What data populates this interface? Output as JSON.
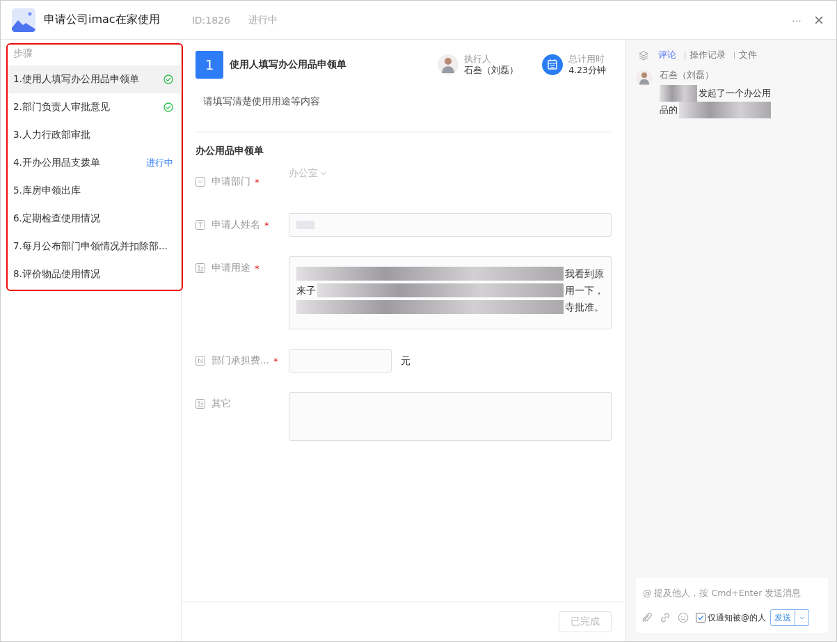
{
  "window": {
    "title": "申请公司imac在家使用",
    "id": "ID:1826",
    "status": "进行中",
    "more": "···",
    "close": "×"
  },
  "steps": {
    "title": "步骤",
    "highlighted": true,
    "items": [
      {
        "label": "1.使用人填写办公用品申领单",
        "selected": true,
        "completed": true
      },
      {
        "label": "2.部门负责人审批意见",
        "selected": false,
        "completed": true
      },
      {
        "label": "3.人力行政部审批",
        "selected": false,
        "completed": false
      },
      {
        "label": "4.开办公用品支拨单",
        "selected": false,
        "completed": false,
        "badge": "进行中"
      },
      {
        "label": "5.库房申领出库",
        "selected": false,
        "completed": false
      },
      {
        "label": "6.定期检查使用情况",
        "selected": false,
        "completed": false
      },
      {
        "label": "7.每月公布部门申领情况并扣除部...",
        "selected": false,
        "completed": false
      },
      {
        "label": "8.评价物品使用情况",
        "selected": false,
        "completed": false
      }
    ]
  },
  "task": {
    "number": "1",
    "title": "使用人填写办公用品申领单",
    "executor_label": "执行人",
    "executor": "石叁（刘磊）",
    "time_label": "总计用时",
    "time": "4.23分钟",
    "description": "请填写清楚使用用途等内容"
  },
  "form": {
    "title": "办公用品申领单",
    "fields": [
      {
        "kind": "select",
        "label": "申请部门",
        "required_mark": "*",
        "value": "办公室"
      },
      {
        "kind": "input",
        "label": "申请人姓名",
        "required_mark": "*",
        "segments": [
          {
            "kind": "redacted"
          }
        ]
      },
      {
        "kind": "textarea",
        "label": "申请用途",
        "required_mark": "*",
        "lines": [
          [
            {
              "kind": "redacted"
            },
            {
              "kind": "text",
              "text": "我看到原"
            }
          ],
          [
            {
              "kind": "text",
              "text": "来子"
            },
            {
              "kind": "redacted"
            },
            {
              "kind": "text",
              "text": "用一下，"
            }
          ],
          [
            {
              "kind": "redacted"
            },
            {
              "kind": "text",
              "text": "寺批准。"
            }
          ]
        ]
      },
      {
        "kind": "number",
        "label": "部门承担费...",
        "required_mark": "*",
        "unit": "元"
      },
      {
        "kind": "textarea",
        "label": "其它"
      }
    ]
  },
  "footer": {
    "button": "已完成",
    "disabled": true
  },
  "activity": {
    "tabs": [
      {
        "label": "评论",
        "selected": true
      },
      {
        "label": "操作记录",
        "selected": false
      },
      {
        "label": "文件",
        "selected": false
      }
    ],
    "comments": [
      {
        "author": "石叁（刘磊）",
        "lines": [
          [
            {
              "kind": "redacted"
            },
            {
              "kind": "text",
              "text": "发起了一个办公用"
            }
          ],
          [
            {
              "kind": "text",
              "text": "品的"
            },
            {
              "kind": "redacted"
            }
          ]
        ]
      }
    ]
  },
  "composer": {
    "placeholder": "@ 提及他人，按 Cmd+Enter 发送消息",
    "notify_label": "仅通知被@的人",
    "notify_checked": true,
    "send": "发送"
  }
}
